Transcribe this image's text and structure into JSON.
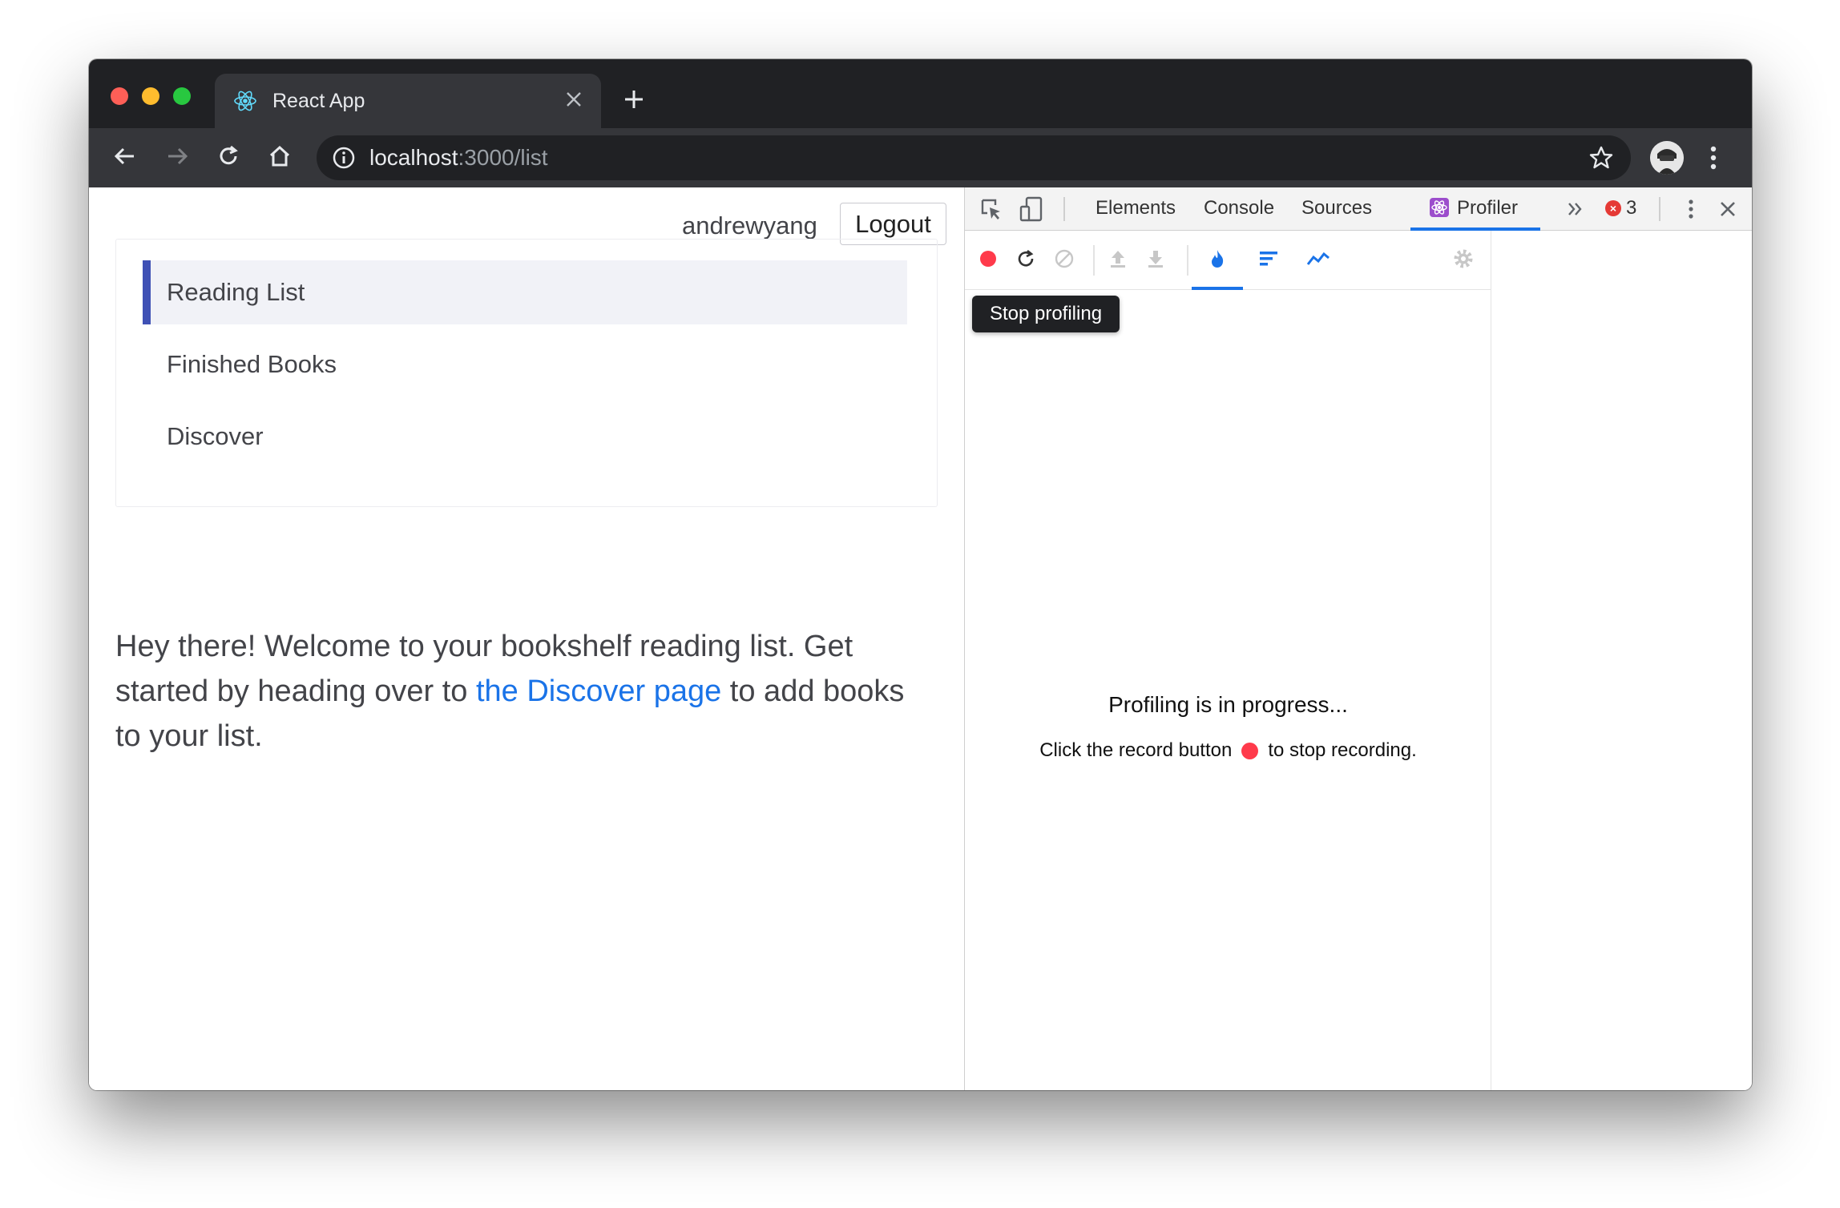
{
  "browser": {
    "tab_title": "React App",
    "url_host": "localhost",
    "url_path": ":3000/list",
    "icons": {
      "tab": "react-logo-icon",
      "back": "arrow-left-icon",
      "forward": "arrow-right-icon",
      "reload": "reload-icon",
      "home": "home-icon",
      "info": "info-icon",
      "star": "star-icon",
      "menu": "kebab-menu-icon"
    }
  },
  "app": {
    "username": "andrewyang",
    "logout_label": "Logout",
    "nav": [
      {
        "label": "Reading List",
        "active": true
      },
      {
        "label": "Finished Books",
        "active": false
      },
      {
        "label": "Discover",
        "active": false
      }
    ],
    "welcome_before": "Hey there! Welcome to your bookshelf reading list. Get started by heading over to ",
    "welcome_link": "the Discover page",
    "welcome_after": " to add books to your list.",
    "accent_color": "#3f51b5",
    "link_color": "#1a73e8"
  },
  "devtools": {
    "tabs": [
      "Elements",
      "Console",
      "Sources",
      "Profiler"
    ],
    "active_tab": "Profiler",
    "error_count": "3",
    "tooltip": "Stop profiling",
    "progress_title": "Profiling is in progress...",
    "progress_sub_before": "Click the record button",
    "progress_sub_after": "to stop recording.",
    "record_color": "#ff3a4b"
  }
}
